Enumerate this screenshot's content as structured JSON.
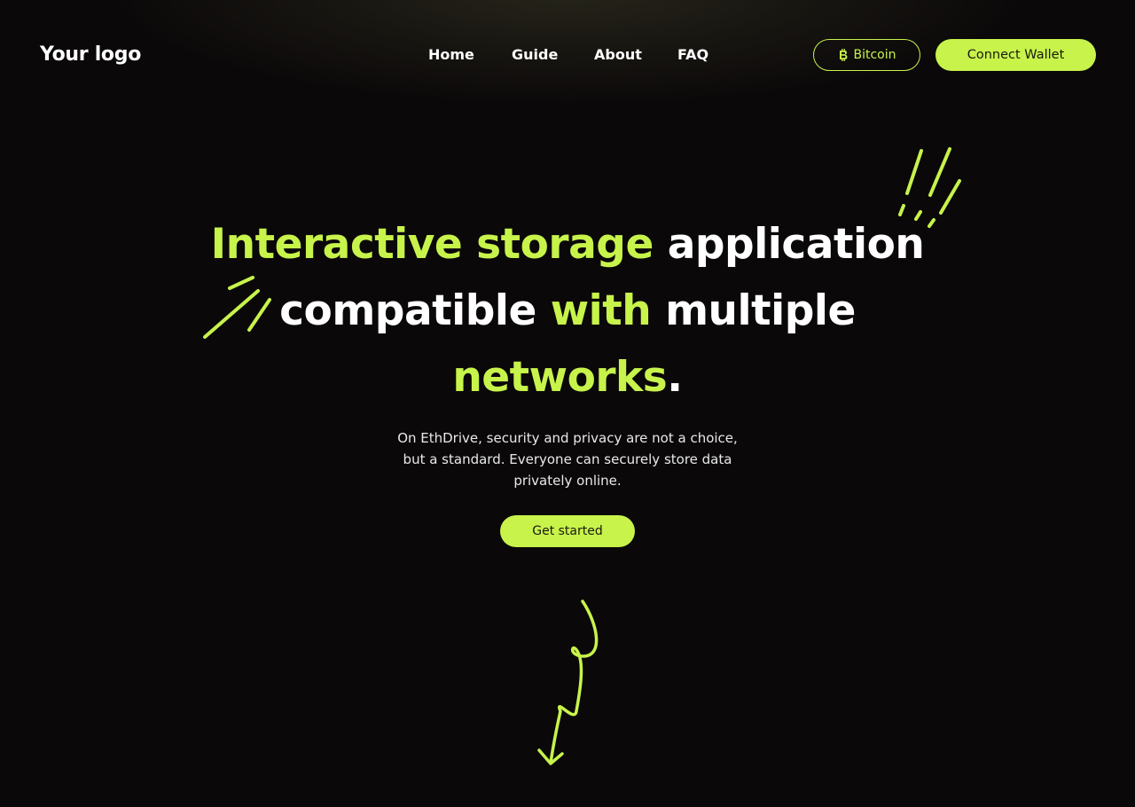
{
  "header": {
    "logo": "Your logo",
    "nav": [
      {
        "label": "Home"
      },
      {
        "label": "Guide"
      },
      {
        "label": "About"
      },
      {
        "label": "FAQ"
      }
    ],
    "bitcoin_button": {
      "label": "Bitcoin",
      "icon": "bitcoin-icon"
    },
    "connect_button": {
      "label": "Connect Wallet"
    }
  },
  "hero": {
    "title": {
      "line1_accent": "Interactive storage",
      "line1_rest": " application",
      "line2_start": "compatible ",
      "line2_accent": "with",
      "line2_end": " multiple",
      "line3_accent": "networks",
      "line3_end": "."
    },
    "description": "On EthDrive, security and privacy are not a choice, but a standard. Everyone can securely store data privately online.",
    "cta_label": "Get started"
  },
  "decorations": {
    "icons": [
      "sparkle-lines-top-right",
      "sparkle-lines-left",
      "squiggle-arrow-down"
    ]
  },
  "colors": {
    "accent": "#c7f34b",
    "background": "#0b0809",
    "text": "#ffffff"
  }
}
